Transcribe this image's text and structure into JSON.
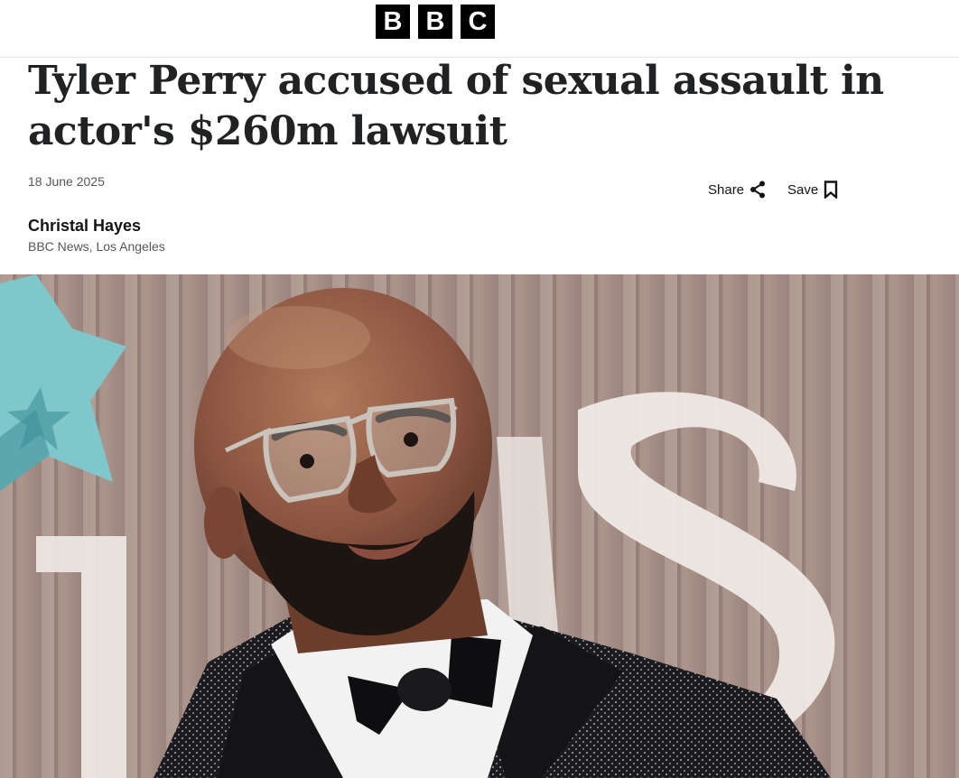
{
  "header": {
    "logo_letters": [
      "B",
      "B",
      "C"
    ]
  },
  "article": {
    "headline": "Tyler Perry accused of sexual assault in actor's $260m lawsuit",
    "date": "18 June 2025",
    "author": "Christal Hayes",
    "author_role": "BBC News, Los Angeles"
  },
  "actions": {
    "share_label": "Share",
    "save_label": "Save"
  },
  "hero": {
    "alt": "Tyler Perry at a red carpet event wearing glasses and a bow tie"
  },
  "colors": {
    "background": "#ffffff",
    "text": "#141414",
    "meta": "#545658",
    "logo_block": "#000000"
  }
}
